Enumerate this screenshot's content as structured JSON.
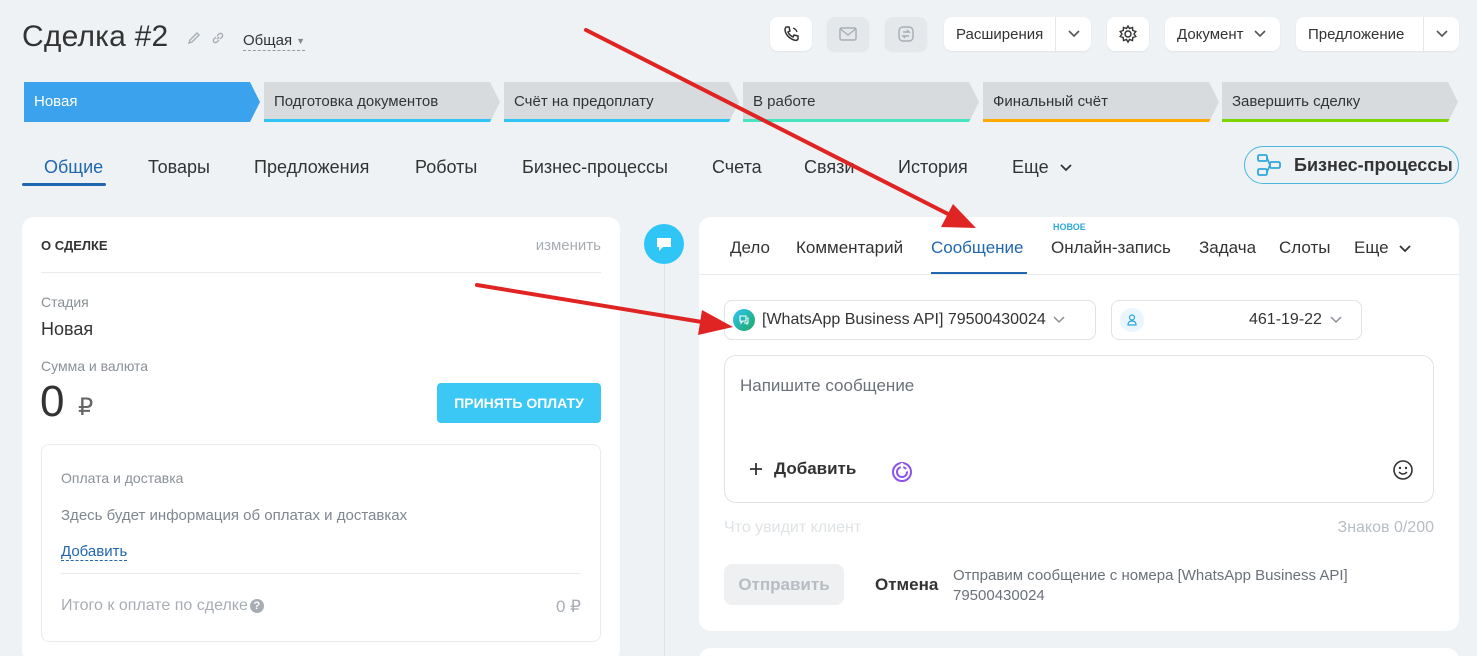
{
  "header": {
    "title": "Сделка #2",
    "category": "Общая",
    "extensions_label": "Расширения",
    "document_label": "Документ",
    "proposal_label": "Предложение"
  },
  "stages": [
    {
      "label": "Новая",
      "color": "#3ba3ee",
      "active": true
    },
    {
      "label": "Подготовка документов",
      "color": "#2fc6f6"
    },
    {
      "label": "Счёт на предоплату",
      "color": "#2fc6f6"
    },
    {
      "label": "В работе",
      "color": "#47e4c2"
    },
    {
      "label": "Финальный счёт",
      "color": "#ffa900"
    },
    {
      "label": "Завершить сделку",
      "color": "#7bd500"
    }
  ],
  "tabs": [
    "Общие",
    "Товары",
    "Предложения",
    "Роботы",
    "Бизнес-процессы",
    "Счета",
    "Связи",
    "История",
    "Еще"
  ],
  "bp_button": "Бизнес-процессы",
  "about": {
    "heading": "О СДЕЛКЕ",
    "edit": "изменить",
    "stage_label": "Стадия",
    "stage_value": "Новая",
    "sum_label": "Сумма и валюта",
    "sum_value": "0",
    "currency": "₽",
    "pay_button": "ПРИНЯТЬ ОПЛАТУ",
    "payment_title": "Оплата и доставка",
    "payment_info": "Здесь будет информация об оплатах и доставках",
    "payment_add": "Добавить",
    "total_label": "Итого к оплате по сделке",
    "total_value": "0 ₽"
  },
  "activity": {
    "tabs": [
      "Дело",
      "Комментарий",
      "Сообщение",
      "Онлайн-запись",
      "Задача",
      "Слоты",
      "Еще"
    ],
    "new_badge": "НОВОЕ",
    "channel": "[WhatsApp Business API] 79500430024",
    "contact_phone": "461-19-22",
    "message_placeholder": "Напишите сообщение",
    "add_label": "Добавить",
    "client_hint": "Что увидит клиент",
    "char_count": "Знаков 0/200",
    "send_label": "Отправить",
    "cancel_label": "Отмена",
    "send_note": "Отправим сообщение с номера [WhatsApp Business API] 79500430024"
  },
  "colors": {
    "accent": "#2067b0",
    "arrow": "#e02424",
    "pay_button": "#3bc8f5"
  }
}
